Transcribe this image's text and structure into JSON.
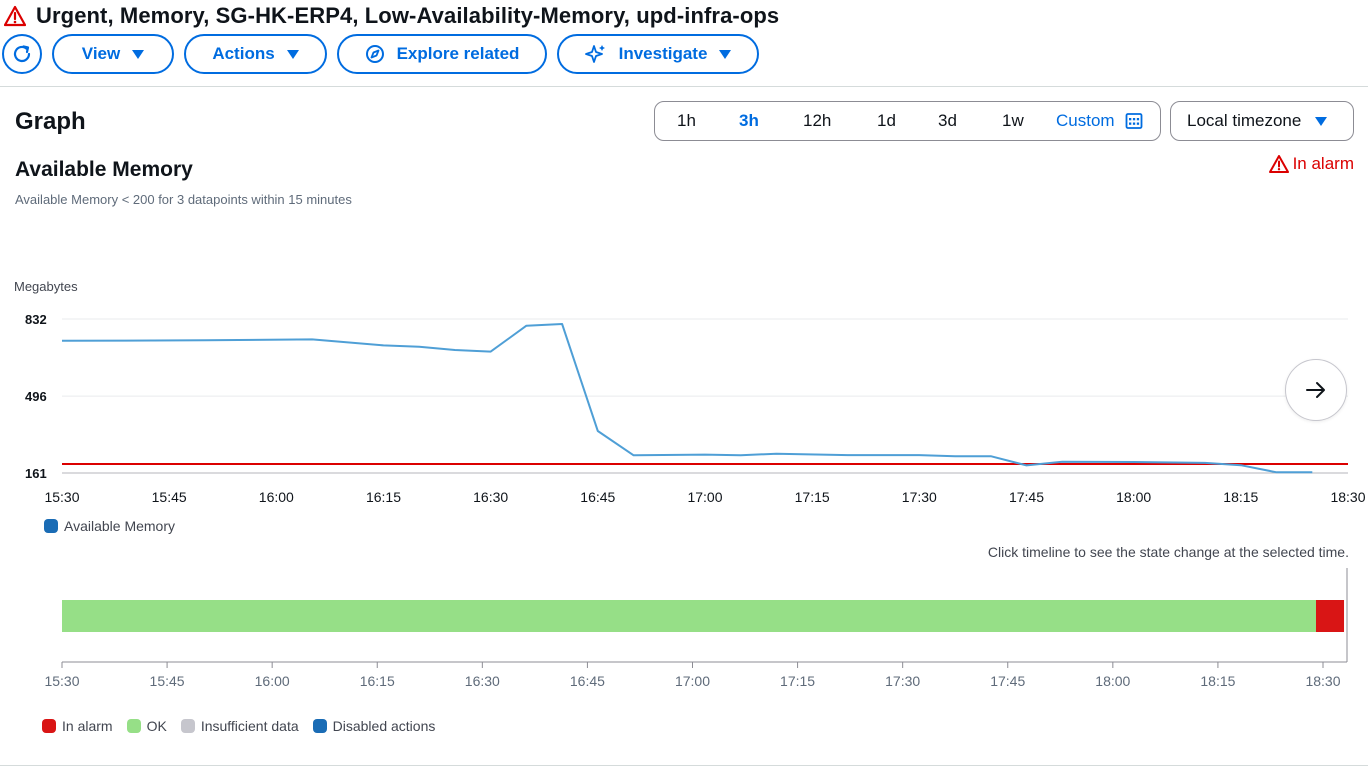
{
  "header": {
    "title": "Urgent, Memory, SG-HK-ERP4, Low-Availability-Memory, upd-infra-ops",
    "warning_icon": "warning-triangle-icon"
  },
  "toolbar": {
    "refresh_icon": "refresh-icon",
    "view_label": "View",
    "actions_label": "Actions",
    "explore_label": "Explore related",
    "investigate_label": "Investigate"
  },
  "graph": {
    "title": "Graph",
    "time_ranges": [
      "1h",
      "3h",
      "12h",
      "1d",
      "3d",
      "1w"
    ],
    "active_range": "3h",
    "custom_label": "Custom",
    "timezone_label": "Local timezone"
  },
  "alarm": {
    "name": "Available Memory",
    "description": "Available Memory < 200 for 3 datapoints within 15 minutes",
    "state_label": "In alarm"
  },
  "colors": {
    "accent": "#006ce0",
    "series": "#4f9fd6",
    "threshold": "#db0000",
    "ok": "#96df87",
    "alarm": "#d91515",
    "insufficient": "#c6c6cd",
    "disabled": "#1a6cb5"
  },
  "chart_data": {
    "type": "line",
    "ylabel": "Megabytes",
    "yticks": [
      832,
      496,
      161
    ],
    "ylim": [
      161,
      832
    ],
    "xticks": [
      "15:30",
      "15:45",
      "16:00",
      "16:15",
      "16:30",
      "16:45",
      "17:00",
      "17:15",
      "17:30",
      "17:45",
      "18:00",
      "18:15",
      "18:30"
    ],
    "threshold": 200,
    "series": [
      {
        "name": "Available Memory",
        "x": [
          "15:30",
          "15:50",
          "16:05",
          "16:15",
          "16:20",
          "16:25",
          "16:30",
          "16:35",
          "16:40",
          "16:45",
          "16:50",
          "17:00",
          "17:05",
          "17:10",
          "17:20",
          "17:30",
          "17:35",
          "17:40",
          "17:45",
          "17:50",
          "18:00",
          "18:10",
          "18:15",
          "18:20",
          "18:25"
        ],
        "y": [
          737,
          739,
          743,
          717,
          711,
          697,
          690,
          803,
          810,
          344,
          238,
          241,
          238,
          245,
          239,
          239,
          234,
          234,
          194,
          210,
          209,
          205,
          195,
          164,
          164
        ]
      }
    ],
    "legend": [
      "Available Memory"
    ]
  },
  "timeline": {
    "hint": "Click timeline to see the state change at the selected time.",
    "ticks": [
      "15:30",
      "15:45",
      "16:00",
      "16:15",
      "16:30",
      "16:45",
      "17:00",
      "17:15",
      "17:30",
      "17:45",
      "18:00",
      "18:15",
      "18:30"
    ],
    "segments": [
      {
        "state": "OK",
        "from": "15:30",
        "to": "18:29"
      },
      {
        "state": "In alarm",
        "from": "18:29",
        "to": "18:33"
      }
    ],
    "legend": [
      "In alarm",
      "OK",
      "Insufficient data",
      "Disabled actions"
    ]
  }
}
